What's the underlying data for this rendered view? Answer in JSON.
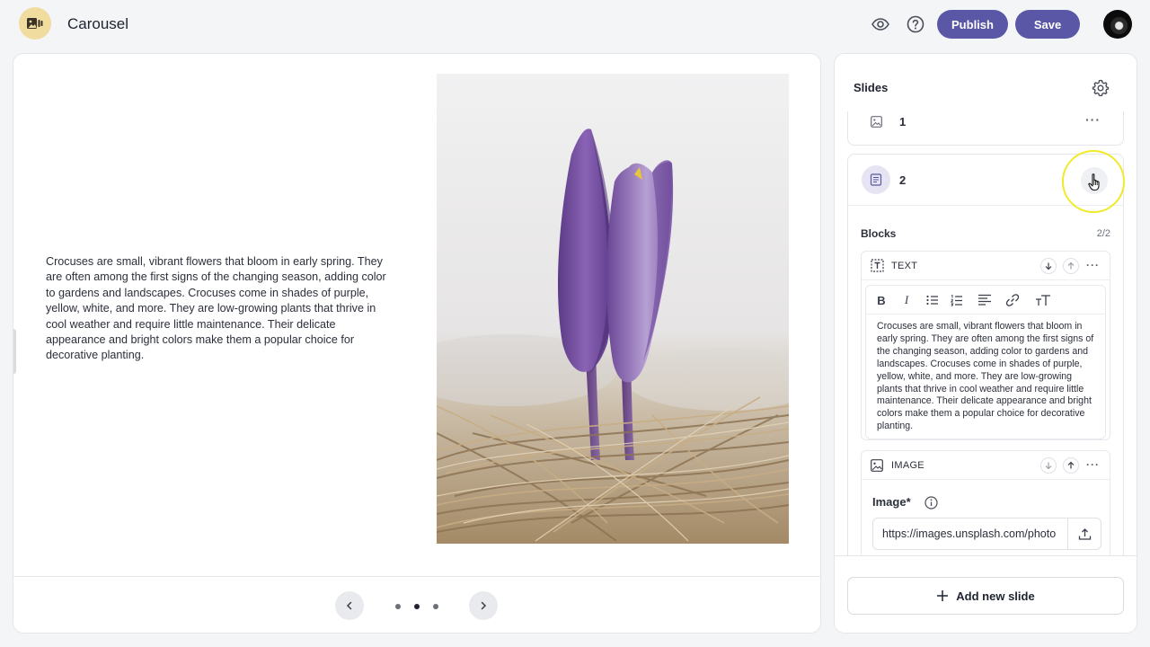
{
  "app": {
    "title": "Carousel"
  },
  "header": {
    "publish_label": "Publish",
    "save_label": "Save"
  },
  "slide_content": {
    "text": "Crocuses are small, vibrant flowers that bloom in early spring. They are often among the first signs of the changing season, adding color to gardens and landscapes. Crocuses come in shades of purple, yellow, white, and more. They are low-growing plants that thrive in cool weather and require little maintenance. Their delicate appearance and bright colors make them a popular choice for decorative planting."
  },
  "pagination": {
    "total": 3,
    "active_index": 1
  },
  "sidebar": {
    "title": "Slides",
    "slides": [
      {
        "number": "1",
        "type_icon": "image-icon"
      },
      {
        "number": "2",
        "type_icon": "text-doc-icon"
      }
    ],
    "blocks_label": "Blocks",
    "blocks_count": "2/2",
    "blocks": [
      {
        "name": "TEXT",
        "icon": "text-block-icon"
      },
      {
        "name": "IMAGE",
        "icon": "image-icon"
      }
    ],
    "editor_text": "Crocuses are small, vibrant flowers that bloom in early spring. They are often among the first signs of the changing season, adding color to gardens and landscapes. Crocuses come in shades of purple, yellow, white, and more. They are low-growing plants that thrive in cool weather and require little maintenance. Their delicate appearance and bright colors make them a popular choice for decorative planting.",
    "image_field_label": "Image*",
    "image_url_value": "https://images.unsplash.com/photo",
    "add_slide_label": "Add new slide"
  },
  "colors": {
    "primary": "#5a57a6",
    "logo_bg": "#f1dca0",
    "highlight": "#f0ea2a"
  }
}
